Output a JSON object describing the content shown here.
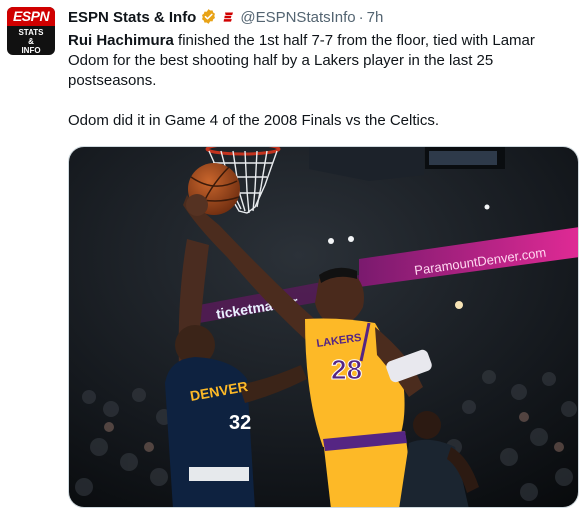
{
  "account": {
    "display_name": "ESPN Stats & Info",
    "handle": "@ESPNStatsInfo",
    "separator": "·",
    "time": "7h",
    "avatar": {
      "logo": "ESPN",
      "line1": "STATS",
      "line2": "&",
      "line3": "INFO"
    }
  },
  "tweet": {
    "highlight": "Rui Hachimura",
    "text1": " finished the 1st half 7-7 from the floor, tied with Lamar Odom for the best shooting half by a Lakers player in the last 25 postseasons.",
    "text2": "Odom did it in Game 4 of the 2008 Finals vs the Celtics."
  },
  "media": {
    "banner_text": "ParamountDenver.com",
    "banner_text2": "ticketmaster",
    "jersey_lakers": "LAKERS",
    "jersey_lakers_number": "28",
    "jersey_denver": "DENVER",
    "jersey_denver_number": "32"
  },
  "icons": [
    "verified-badge-icon",
    "espn-affiliate-icon"
  ],
  "colors": {
    "verified": "#f4b400",
    "lakers_gold": "#fdb927",
    "lakers_purple": "#552583",
    "nuggets_navy": "#0e2240",
    "banner_magenta": "#d01e8c"
  }
}
